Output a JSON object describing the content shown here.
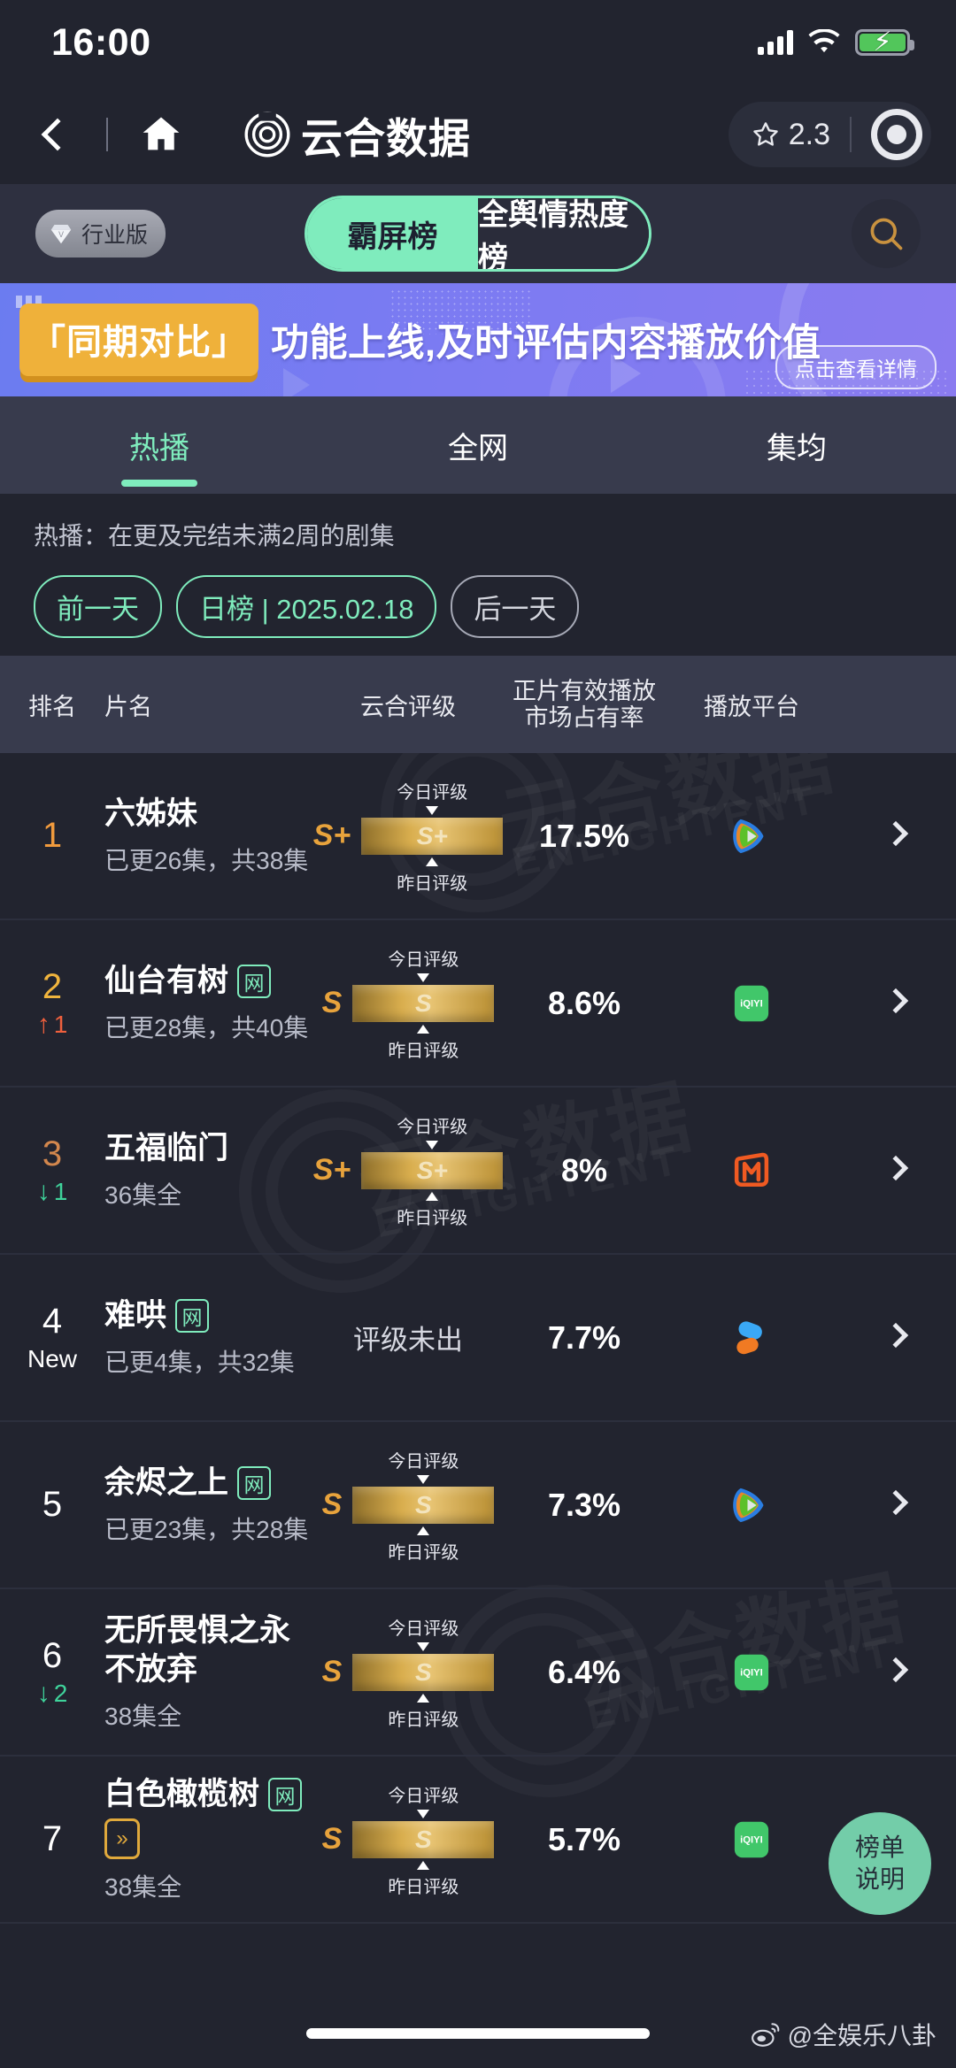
{
  "status_bar": {
    "time": "16:00",
    "signal_icon": "signal-bars-icon",
    "wifi_icon": "wifi-icon",
    "battery_icon": "battery-charging-icon"
  },
  "app_bar": {
    "back_icon": "back-chevron-icon",
    "home_icon": "home-icon",
    "brand_logo": "yunhe-logo-icon",
    "brand_title": "云合数据",
    "rating_icon": "star-outline-icon",
    "rating_value": "2.3",
    "record_icon": "record-circle-icon"
  },
  "top_row": {
    "industry_badge": {
      "label": "行业版",
      "icon": "diamond-icon"
    },
    "segments": [
      {
        "label": "霸屏榜",
        "active": true
      },
      {
        "label": "全舆情热度榜",
        "active": false
      }
    ],
    "search_icon": "search-icon"
  },
  "banner": {
    "tag": "「同期对比」",
    "text": "功能上线,及时评估内容播放价值",
    "cta": "点击查看详情",
    "bg_color": "#7b7bf2",
    "tag_color": "#efb13a"
  },
  "sub_tabs": [
    {
      "label": "热播",
      "active": true
    },
    {
      "label": "全网",
      "active": false
    },
    {
      "label": "集均",
      "active": false
    }
  ],
  "filters": {
    "note": "热播：在更及完结未满2周的剧集",
    "prev_day": "前一天",
    "date_range": "日榜 | 2025.02.18",
    "next_day": "后一天",
    "accent_color": "#7fecbd"
  },
  "table": {
    "headers": {
      "rank": "排名",
      "title": "片名",
      "grade": "云合评级",
      "share_line1": "正片有效播放",
      "share_line2": "市场占有率",
      "platform": "播放平台"
    },
    "grade_labels": {
      "today": "今日评级",
      "yesterday": "昨日评级"
    },
    "rows": [
      {
        "rank": "1",
        "rank_color": "#f09a3d",
        "delta": "",
        "delta_dir": "none",
        "title": "六姊妹",
        "net_tag": "",
        "fast_tag": "",
        "episodes": "已更26集，共38集",
        "grade_letter": "S+",
        "grade_bar": "S+",
        "grade_none": "",
        "share": "17.5%",
        "platform": "tencent-video-logo",
        "chevron": "chevron-right-icon"
      },
      {
        "rank": "2",
        "rank_color": "#f0b43d",
        "delta": "1",
        "delta_dir": "up",
        "title": "仙台有树",
        "net_tag": "网",
        "fast_tag": "",
        "episodes": "已更28集，共40集",
        "grade_letter": "S",
        "grade_bar": "S",
        "grade_none": "",
        "share": "8.6%",
        "platform": "iqiyi-logo",
        "chevron": "chevron-right-icon"
      },
      {
        "rank": "3",
        "rank_color": "#d3874d",
        "delta": "1",
        "delta_dir": "down",
        "title": "五福临门",
        "net_tag": "",
        "fast_tag": "",
        "episodes": "36集全",
        "grade_letter": "S+",
        "grade_bar": "S+",
        "grade_none": "",
        "share": "8%",
        "platform": "mango-tv-logo",
        "chevron": "chevron-right-icon"
      },
      {
        "rank": "4",
        "rank_color": "#ffffff",
        "delta": "New",
        "delta_dir": "new",
        "title": "难哄",
        "net_tag": "网",
        "fast_tag": "",
        "episodes": "已更4集，共32集",
        "grade_letter": "",
        "grade_bar": "",
        "grade_none": "评级未出",
        "share": "7.7%",
        "platform": "youku-logo",
        "chevron": "chevron-right-icon"
      },
      {
        "rank": "5",
        "rank_color": "#ffffff",
        "delta": "",
        "delta_dir": "none",
        "title": "余烬之上",
        "net_tag": "网",
        "fast_tag": "",
        "episodes": "已更23集，共28集",
        "grade_letter": "S",
        "grade_bar": "S",
        "grade_none": "",
        "share": "7.3%",
        "platform": "tencent-video-logo",
        "chevron": "chevron-right-icon"
      },
      {
        "rank": "6",
        "rank_color": "#ffffff",
        "delta": "2",
        "delta_dir": "down",
        "title": "无所畏惧之永不放弃",
        "net_tag": "",
        "fast_tag": "",
        "episodes": "38集全",
        "grade_letter": "S",
        "grade_bar": "S",
        "grade_none": "",
        "share": "6.4%",
        "platform": "iqiyi-logo",
        "chevron": "chevron-right-icon"
      },
      {
        "rank": "7",
        "rank_color": "#ffffff",
        "delta": "",
        "delta_dir": "none",
        "title": "白色橄榄树",
        "net_tag": "网",
        "fast_tag": "▶▶",
        "episodes": "38集全",
        "grade_letter": "S",
        "grade_bar": "S",
        "grade_none": "",
        "share": "5.7%",
        "platform": "iqiyi-logo",
        "chevron": "chevron-right-icon"
      }
    ]
  },
  "fab": {
    "line1": "榜单",
    "line2": "说明",
    "color": "#73cda9"
  },
  "watermark": {
    "brand": "云合数据",
    "sub": "ENLIGHTENT"
  },
  "footer": {
    "credit": "@全娱乐八卦",
    "weibo_icon": "weibo-icon"
  }
}
